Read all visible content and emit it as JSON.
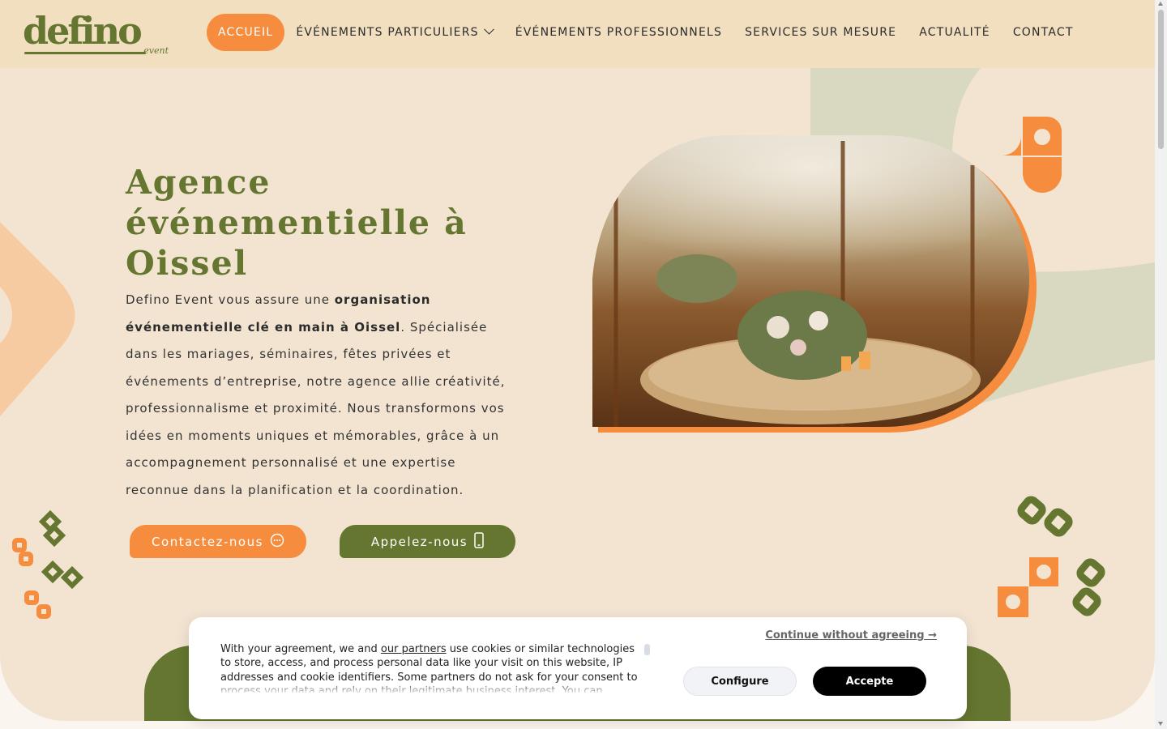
{
  "logo": {
    "word": "defino",
    "sub": "event"
  },
  "nav": {
    "items": [
      {
        "label": "ACCUEIL"
      },
      {
        "label": "ÉVÉNEMENTS PARTICULIERS"
      },
      {
        "label": "ÉVÉNEMENTS PROFESSIONNELS"
      },
      {
        "label": "SERVICES SUR MESURE"
      },
      {
        "label": "ACTUALITÉ"
      },
      {
        "label": "CONTACT"
      }
    ]
  },
  "hero": {
    "title": "Agence événementielle à Oissel",
    "desc_1": "Defino Event vous assure une ",
    "desc_bold": "organisation événementielle clé en main à Oissel",
    "desc_2": ". Spécialisée dans les mariages, séminaires, fêtes privées et événements d’entreprise, notre agence allie créativité, professionnalisme et proximité. Nous transformons vos idées en moments uniques et mémorables, grâce à un accompagnement personnalisé et une expertise reconnue dans la planification et la coordination.",
    "btn_contact": "Contactez-nous",
    "btn_call": "Appelez-nous"
  },
  "cookie": {
    "text_1": "With your agreement, we and ",
    "link": "our partners",
    "text_2": " use cookies or similar technologies to store, access, and process personal data like your visit on this website, IP addresses and cookie identifiers. Some partners do not ask for your consent to process your data and rely on their legitimate business interest. You can",
    "continue": "Continue without agreeing →",
    "configure": "Configure",
    "accept": "Accepte"
  },
  "colors": {
    "green": "#64762f",
    "orange": "#f68c3e",
    "beige": "#f3e4d2",
    "header": "#f2dfc0"
  }
}
